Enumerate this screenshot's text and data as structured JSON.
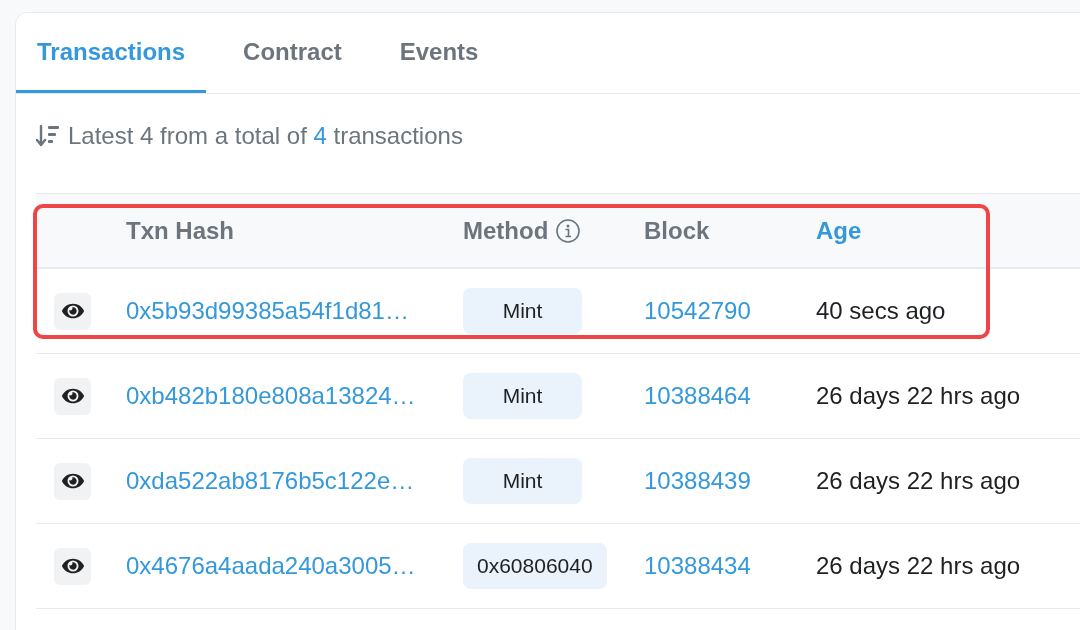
{
  "tabs": [
    {
      "label": "Transactions",
      "selected": true
    },
    {
      "label": "Contract",
      "selected": false
    },
    {
      "label": "Events",
      "selected": false
    }
  ],
  "summary": {
    "before": "Latest 4 from a total of",
    "count": "4",
    "after": "transactions"
  },
  "table": {
    "columns": [
      {
        "label": "Txn Hash",
        "kind": "text",
        "info": false
      },
      {
        "label": "Method",
        "kind": "text",
        "info": true
      },
      {
        "label": "Block",
        "kind": "text",
        "info": false
      },
      {
        "label": "Age",
        "kind": "link",
        "info": false
      }
    ],
    "header_highlighted": true,
    "rows": [
      {
        "hash": "0x5b93d99385a54f1d81…",
        "method": "Mint",
        "block": "10542790",
        "age": "40 secs ago",
        "highlighted": true
      },
      {
        "hash": "0xb482b180e808a13824…",
        "method": "Mint",
        "block": "10388464",
        "age": "26 days 22 hrs ago",
        "highlighted": false
      },
      {
        "hash": "0xda522ab8176b5c122e…",
        "method": "Mint",
        "block": "10388439",
        "age": "26 days 22 hrs ago",
        "highlighted": false
      },
      {
        "hash": "0x4676a4aada240a3005…",
        "method": "0x60806040",
        "block": "10388434",
        "age": "26 days 22 hrs ago",
        "highlighted": false
      }
    ]
  }
}
